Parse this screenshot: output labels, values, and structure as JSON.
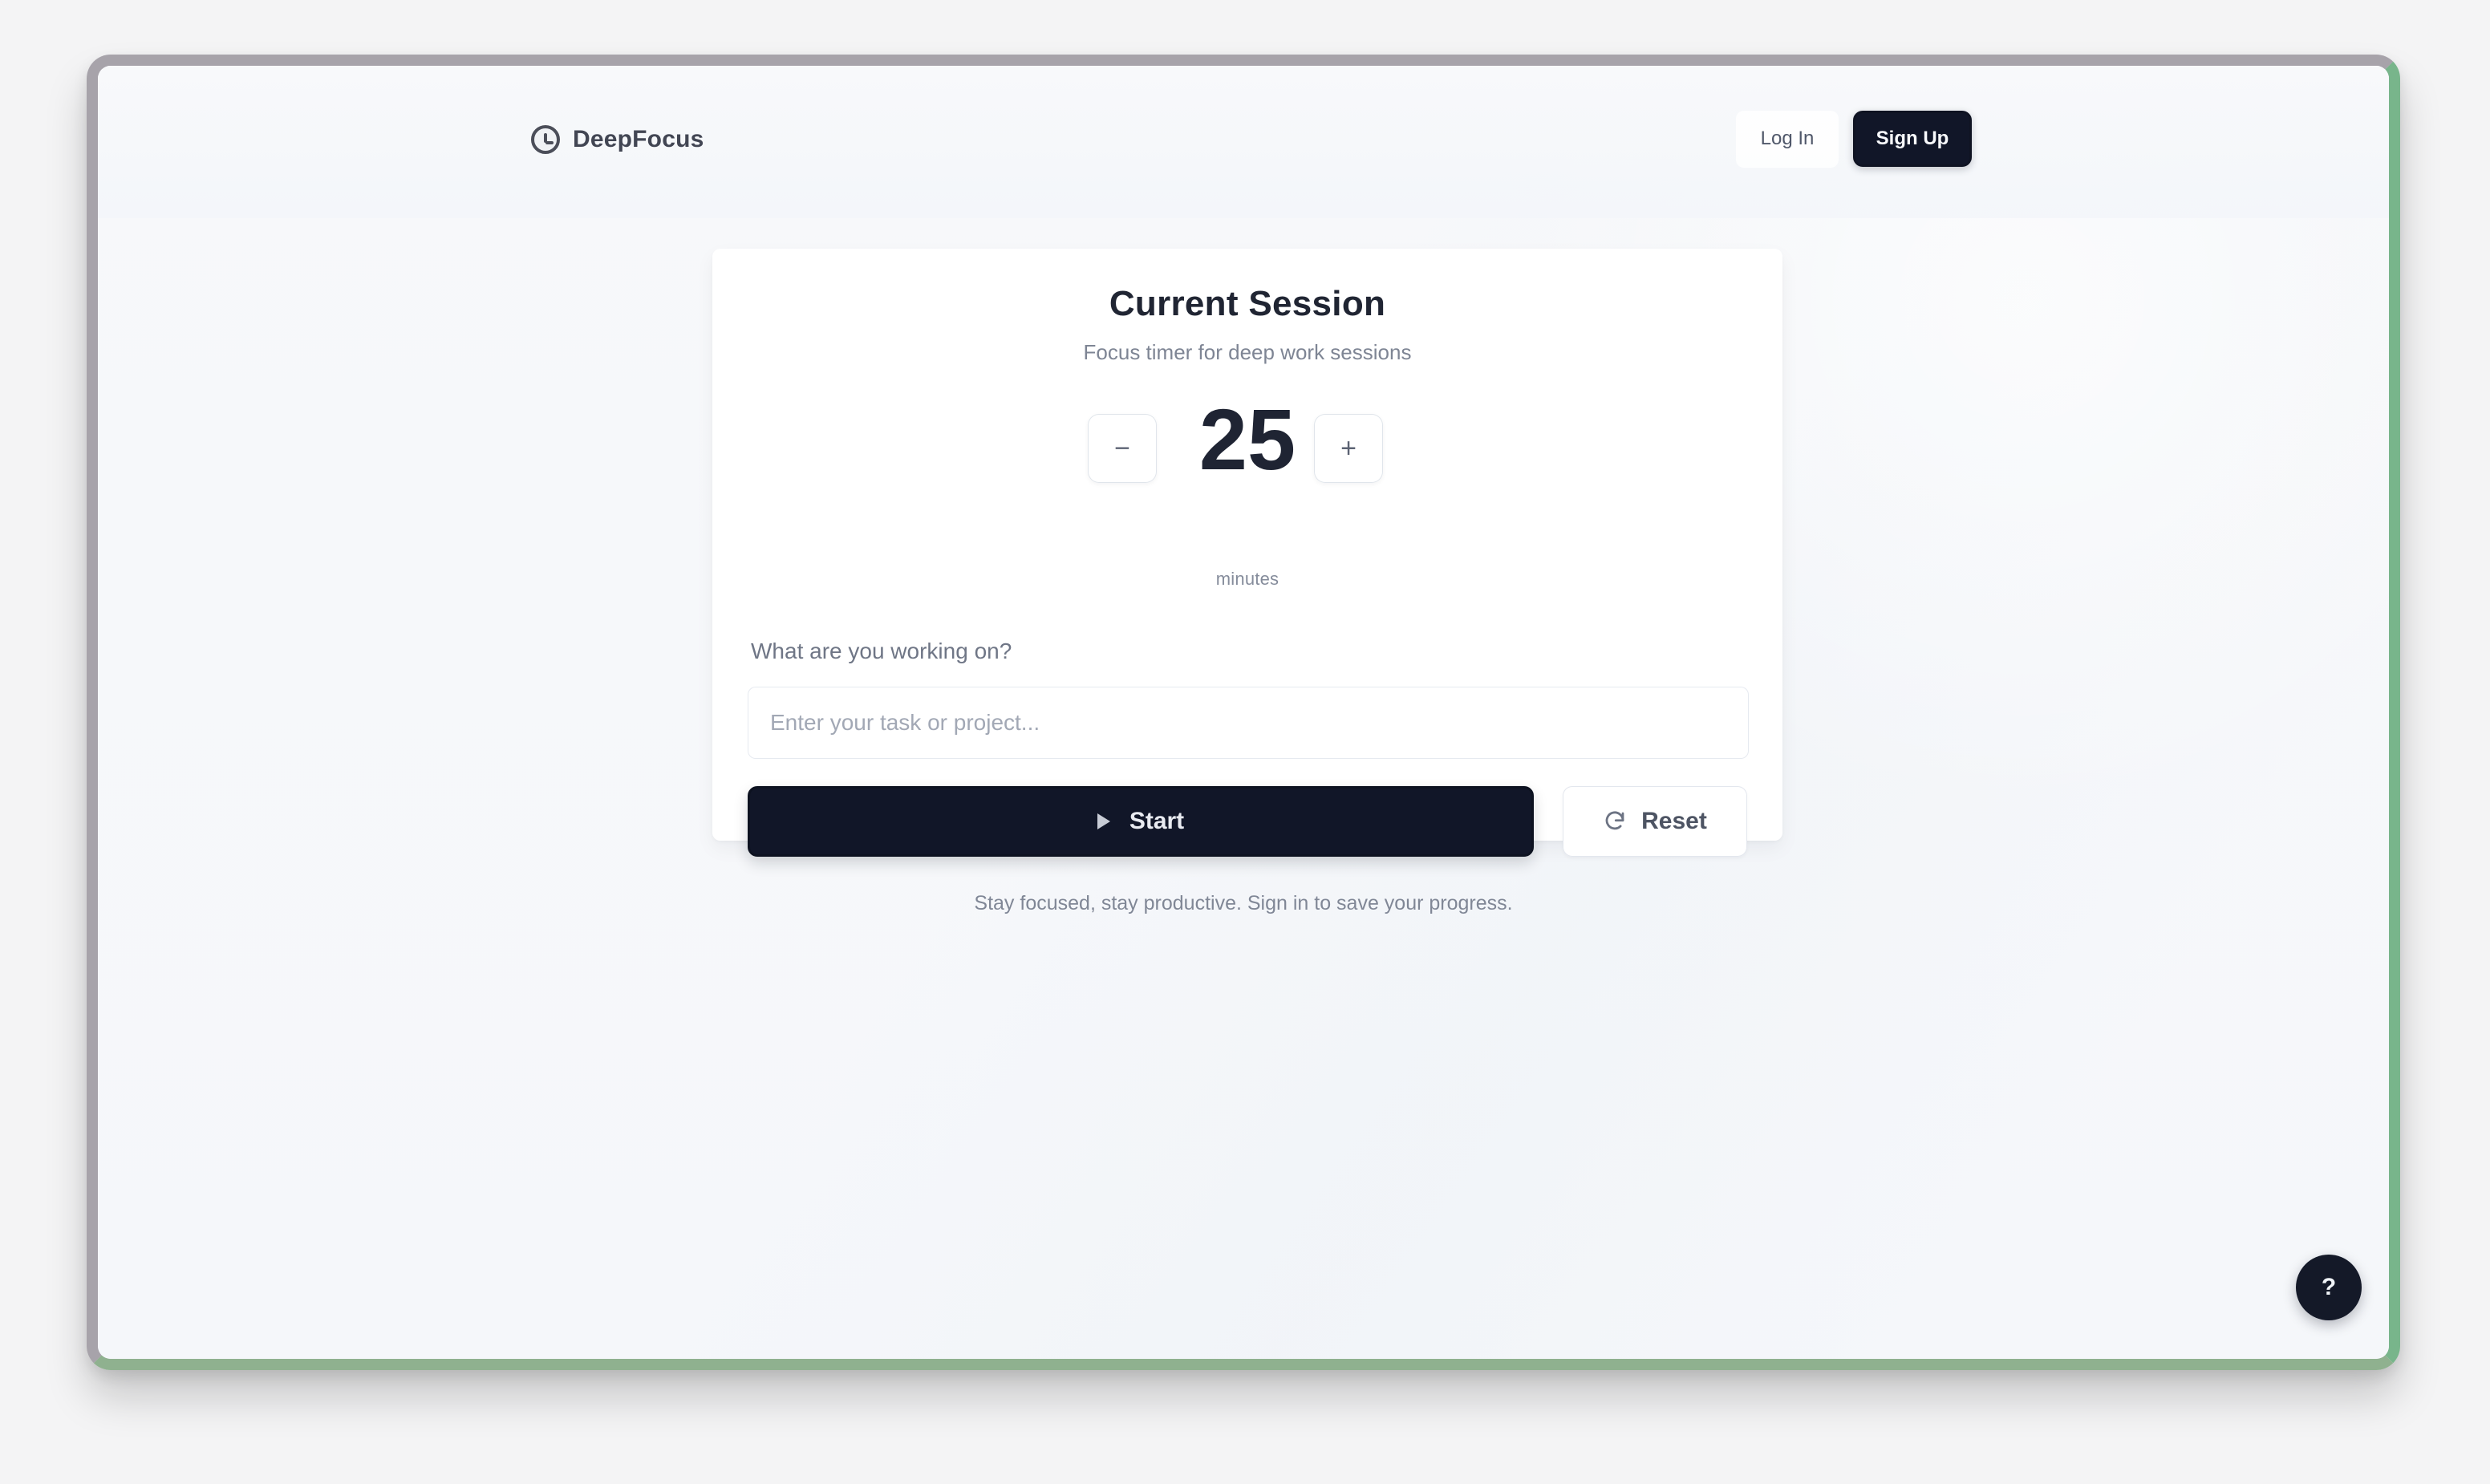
{
  "header": {
    "brand_name": "DeepFocus",
    "log_in": "Log In",
    "sign_up": "Sign Up"
  },
  "session": {
    "title": "Current Session",
    "subtitle": "Focus timer for deep work sessions",
    "minus_label": "−",
    "plus_label": "+",
    "minutes_value": "25",
    "minutes_unit": "minutes",
    "task_label": "What are you working on?",
    "task_placeholder": "Enter your task or project...",
    "start_label": "Start",
    "reset_label": "Reset"
  },
  "footer": {
    "note": "Stay focused, stay productive. Sign in to save your progress."
  },
  "help": {
    "label": "?"
  },
  "icons": {
    "brand": "focus-icon",
    "play": "play-icon",
    "reset": "reset-icon"
  },
  "colors": {
    "primary_dark": "#111628",
    "background": "#f5f7fa",
    "card": "#ffffff",
    "text": "#1f2433",
    "muted": "#7e8594"
  }
}
